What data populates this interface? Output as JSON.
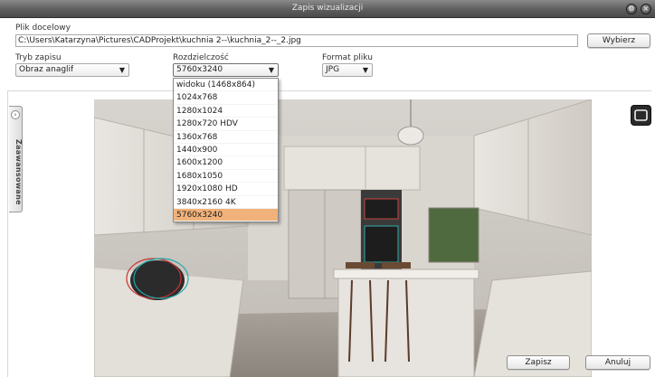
{
  "window": {
    "title": "Zapis wizualizacji"
  },
  "file": {
    "label": "Plik docelowy",
    "path": "C:\\Users\\Katarzyna\\Pictures\\CADProjekt\\kuchnia 2--\\kuchnia_2--_2.jpg",
    "browse_label": "Wybierz"
  },
  "mode": {
    "label": "Tryb zapisu",
    "value": "Obraz anaglif"
  },
  "resolution": {
    "label": "Rozdzielczość",
    "value": "5760x3240",
    "options": [
      "widoku (1468x864)",
      "1024x768",
      "1280x1024",
      "1280x720 HDV",
      "1360x768",
      "1440x900",
      "1600x1200",
      "1680x1050",
      "1920x1080 HD",
      "3840x2160 4K",
      "5760x3240"
    ],
    "selected_index": 10
  },
  "format": {
    "label": "Format pliku",
    "value": "JPG"
  },
  "side_panel": {
    "label": "Zaawansowane"
  },
  "actions": {
    "save_label": "Zapisz",
    "cancel_label": "Anuluj"
  },
  "icons": {
    "settings": "gear-icon",
    "close": "close-icon",
    "dropdown": "chevron-down-icon",
    "expand": "fullscreen-icon",
    "panel_toggle": "chevron-right-icon"
  },
  "colors": {
    "titlebar": "#5e5e5e",
    "selected_option": "#f0b27a"
  }
}
